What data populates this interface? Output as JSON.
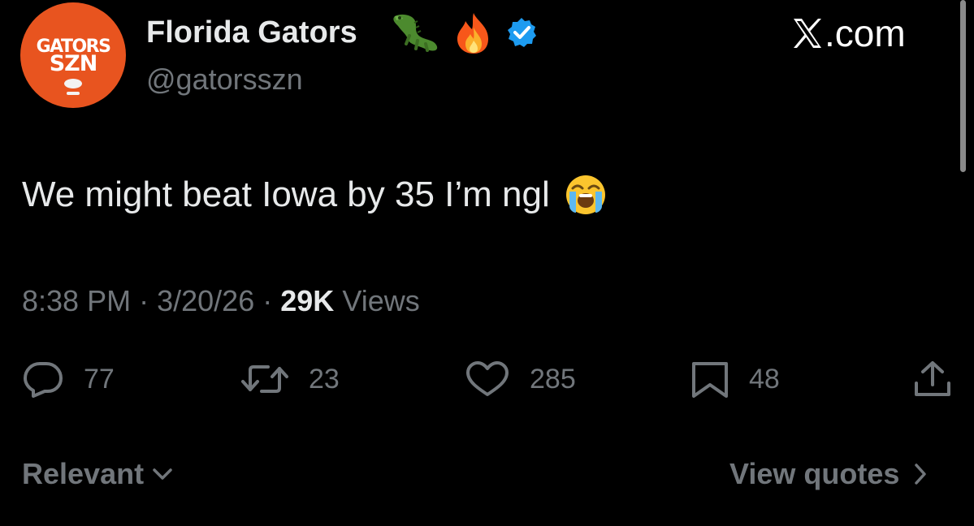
{
  "author": {
    "avatar_line1": "GATORS",
    "avatar_line2": "SZN",
    "display_name": "Florida Gators",
    "name_emojis": [
      "alligator-emoji",
      "fire-emoji",
      "verified-badge-icon"
    ],
    "handle": "@gatorsszn"
  },
  "brand": {
    "text": ".com",
    "logo": "x-logo-icon"
  },
  "tweet": {
    "text": "We might beat Iowa by 35 I’m ngl",
    "emoji": "loudly-crying-face-emoji"
  },
  "meta": {
    "time": "8:38 PM",
    "separator": "·",
    "date": "3/20/26",
    "views_count": "29K",
    "views_label": "Views"
  },
  "actions": {
    "replies": {
      "icon": "reply-icon",
      "count": "77"
    },
    "reposts": {
      "icon": "repost-icon",
      "count": "23"
    },
    "likes": {
      "icon": "heart-icon",
      "count": "285"
    },
    "bookmarks": {
      "icon": "bookmark-icon",
      "count": "48"
    },
    "share": {
      "icon": "share-icon"
    }
  },
  "footer": {
    "sort_label": "Relevant",
    "view_quotes_label": "View quotes"
  },
  "colors": {
    "background": "#000000",
    "primary_text": "#e7e9ea",
    "secondary_text": "#71767b",
    "avatar_orange": "#e8541f",
    "verified_blue": "#1d9bf0"
  }
}
